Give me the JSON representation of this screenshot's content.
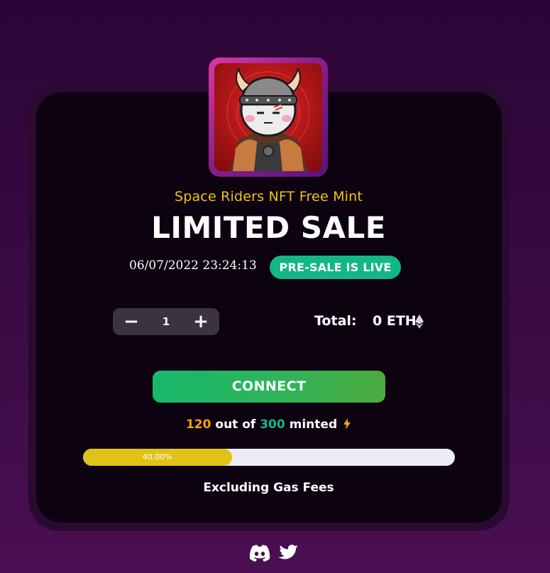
{
  "header": {
    "subtitle": "Space Riders NFT Free Mint",
    "title": "LIMITED SALE"
  },
  "sale": {
    "datetime": "06/07/2022 23:24:13",
    "status_badge": "PRE-SALE IS LIVE"
  },
  "mint": {
    "quantity": "1",
    "minus_symbol": "−",
    "plus_symbol": "+",
    "total_label": "Total:",
    "total_value": "0 ETH",
    "currency_icon": "ethereum-icon",
    "connect_label": "CONNECT"
  },
  "supply": {
    "minted": "120",
    "out_of_text": "out of",
    "max": "300",
    "minted_text": "minted",
    "icon": "lightning-icon",
    "progress_percent": 40,
    "progress_label": "40.00%"
  },
  "footer": {
    "note": "Excluding Gas Fees",
    "social_icons": [
      "discord-icon",
      "twitter-icon"
    ]
  },
  "colors": {
    "accent_yellow": "#f0c419",
    "accent_green": "#13b785",
    "minted_orange": "#f0a117",
    "progress_fill": "#dfc316",
    "card_bg": "#0c0210",
    "page_bg": "#3a0b44"
  }
}
